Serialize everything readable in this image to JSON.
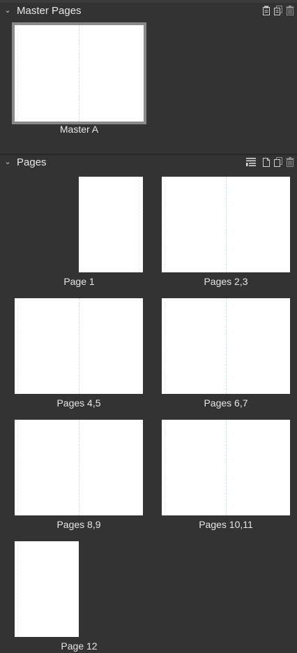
{
  "master_section": {
    "title": "Master Pages",
    "items": [
      {
        "label": "Master A"
      }
    ]
  },
  "pages_section": {
    "title": "Pages",
    "items": [
      {
        "label": "Page 1"
      },
      {
        "label": "Pages 2,3"
      },
      {
        "label": "Pages 4,5"
      },
      {
        "label": "Pages 6,7"
      },
      {
        "label": "Pages 8,9"
      },
      {
        "label": "Pages 10,11"
      },
      {
        "label": "Page 12"
      }
    ]
  },
  "icons": {
    "chevron": "chevron-down-icon",
    "master_tools": [
      "new-master-page-icon",
      "duplicate-master-icon",
      "delete-master-icon"
    ],
    "pages_tools": [
      "page-options-icon",
      "new-page-icon",
      "duplicate-page-icon",
      "delete-page-icon"
    ]
  }
}
